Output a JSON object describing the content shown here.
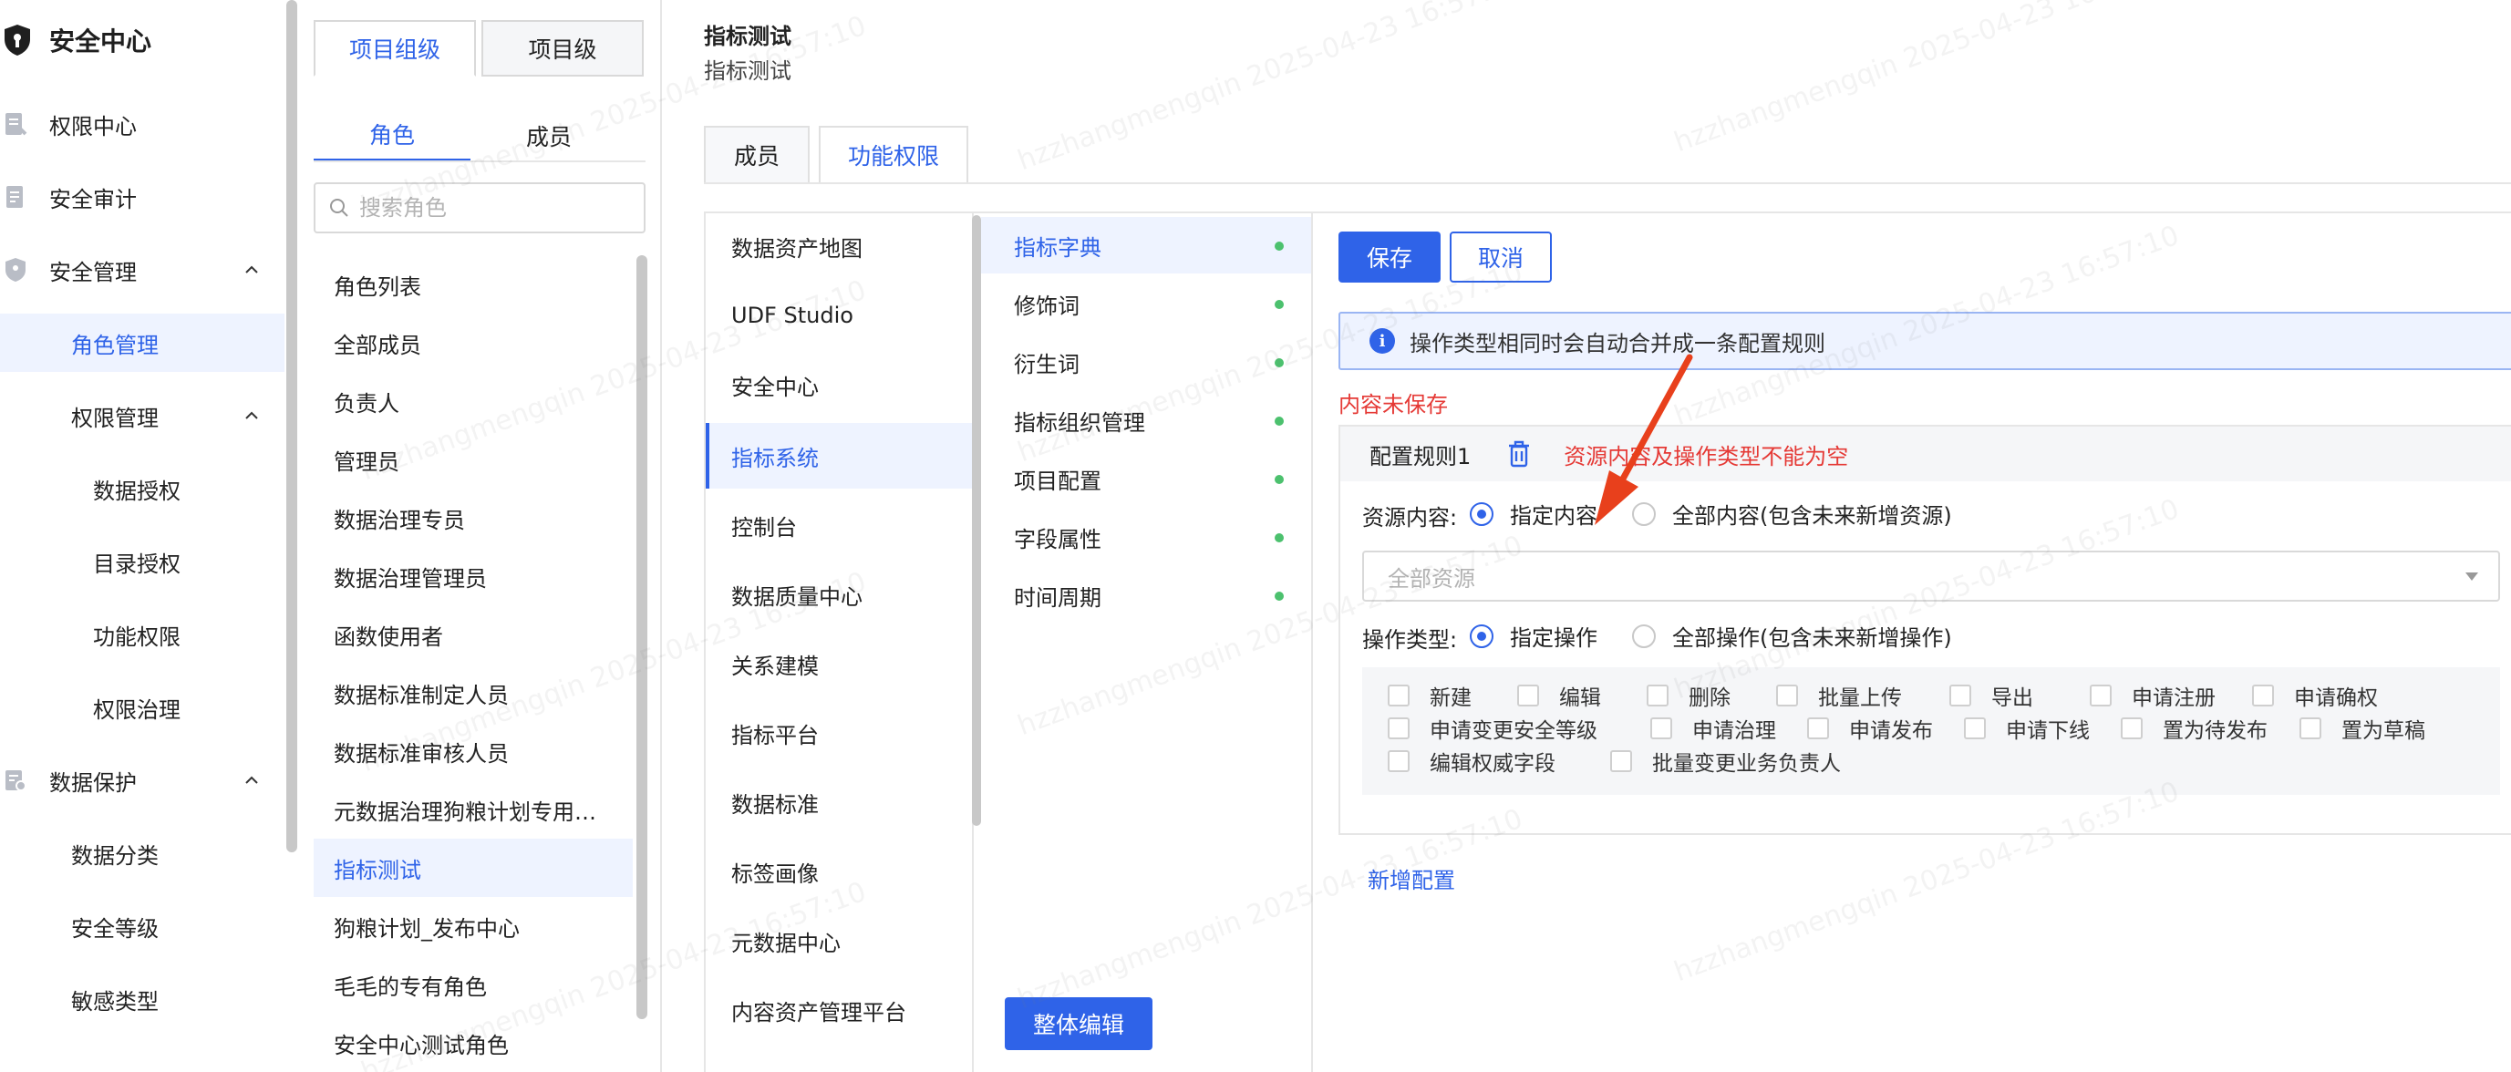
{
  "nav": {
    "title": "安全中心",
    "items": [
      {
        "label": "权限中心",
        "icon": "permission-icon"
      },
      {
        "label": "安全审计",
        "icon": "audit-icon"
      },
      {
        "label": "安全管理",
        "icon": "shield-icon"
      },
      {
        "label": "角色管理"
      },
      {
        "label": "权限管理"
      },
      {
        "label": "数据授权"
      },
      {
        "label": "目录授权"
      },
      {
        "label": "功能权限"
      },
      {
        "label": "权限治理"
      },
      {
        "label": "数据保护",
        "icon": "data-protect-icon"
      },
      {
        "label": "数据分类"
      },
      {
        "label": "安全等级"
      },
      {
        "label": "敏感类型"
      }
    ]
  },
  "rolepanel": {
    "level_tabs": [
      "项目组级",
      "项目级"
    ],
    "sub_tabs": [
      "角色",
      "成员"
    ],
    "search_placeholder": "搜索角色",
    "roles": [
      "角色列表",
      "全部成员",
      "负责人",
      "管理员",
      "数据治理专员",
      "数据治理管理员",
      "函数使用者",
      "数据标准制定人员",
      "数据标准审核人员",
      "元数据治理狗粮计划专用…",
      "指标测试",
      "狗粮计划_发布中心",
      "毛毛的专有角色",
      "安全中心测试角色"
    ]
  },
  "main": {
    "title": "指标测试",
    "subtitle": "指标测试",
    "tabs": [
      "成员",
      "功能权限"
    ],
    "products": [
      "数据资产地图",
      "UDF Studio",
      "安全中心",
      "指标系统",
      "控制台",
      "数据质量中心",
      "关系建模",
      "指标平台",
      "数据标准",
      "标签画像",
      "元数据中心",
      "内容资产管理平台"
    ],
    "modules": [
      "指标字典",
      "修饰词",
      "衍生词",
      "指标组织管理",
      "项目配置",
      "字段属性",
      "时间周期"
    ],
    "bulk_edit_label": "整体编辑",
    "save_label": "保存",
    "cancel_label": "取消",
    "info_text": "操作类型相同时会自动合并成一条配置规则",
    "unsaved_text": "内容未保存",
    "rule": {
      "title": "配置规则1",
      "error": "资源内容及操作类型不能为空",
      "resource_label": "资源内容:",
      "resource_options": [
        "指定内容",
        "全部内容(包含未来新增资源)"
      ],
      "resource_placeholder": "全部资源",
      "op_label": "操作类型:",
      "op_options": [
        "指定操作",
        "全部操作(包含未来新增操作)"
      ],
      "operations": [
        "新建",
        "编辑",
        "删除",
        "批量上传",
        "导出",
        "申请注册",
        "申请确权",
        "申请变更安全等级",
        "申请治理",
        "申请发布",
        "申请下线",
        "置为待发布",
        "置为草稿",
        "编辑权威字段",
        "批量变更业务负责人"
      ]
    },
    "add_config_label": "新增配置"
  },
  "watermark": "hzzhangmengqin 2025-04-23 16:57:10",
  "colors": {
    "accent": "#2f63e8",
    "error": "#e53935",
    "status_dot": "#4cc16e",
    "active_bg": "#eef3ff",
    "annotation_arrow": "#e8401c"
  }
}
